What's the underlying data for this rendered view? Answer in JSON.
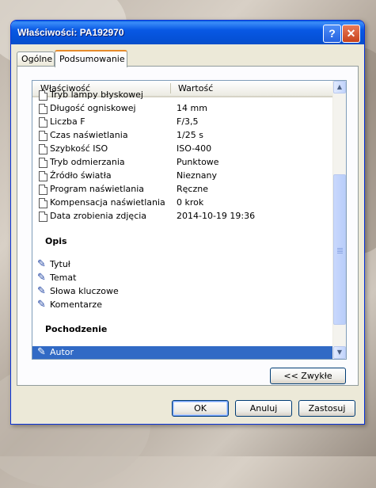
{
  "window": {
    "title": "Właściwości: PA192970"
  },
  "titlebar": {
    "help_glyph": "?",
    "close_glyph": "✕"
  },
  "tabs": [
    {
      "label": "Ogólne"
    },
    {
      "label": "Podsumowanie"
    }
  ],
  "list": {
    "headers": {
      "property": "Właściwość",
      "value": "Wartość"
    },
    "partial_row": {
      "label": "Tryb lampy błyskowej"
    },
    "rows": [
      {
        "label": "Długość ogniskowej",
        "value": "14 mm"
      },
      {
        "label": "Liczba F",
        "value": "F/3,5"
      },
      {
        "label": "Czas naświetlania",
        "value": "1/25 s"
      },
      {
        "label": "Szybkość ISO",
        "value": "ISO-400"
      },
      {
        "label": "Tryb odmierzania",
        "value": "Punktowe"
      },
      {
        "label": "Źródło światła",
        "value": "Nieznany"
      },
      {
        "label": "Program naświetlania",
        "value": "Ręczne"
      },
      {
        "label": "Kompensacja naświetlania",
        "value": "0 krok"
      },
      {
        "label": "Data zrobienia zdjęcia",
        "value": "2014-10-19 19:36"
      }
    ],
    "section_opis": "Opis",
    "opis_items": [
      {
        "label": "Tytuł"
      },
      {
        "label": "Temat"
      },
      {
        "label": "Słowa kluczowe"
      },
      {
        "label": "Komentarze"
      }
    ],
    "section_pochodzenie": "Pochodzenie",
    "pochodzenie_items": [
      {
        "label": "Autor",
        "selected": true
      }
    ]
  },
  "scrollbar": {
    "up_glyph": "▲",
    "down_glyph": "▼"
  },
  "buttons": {
    "simple": "<< Zwykłe",
    "ok": "OK",
    "cancel": "Anuluj",
    "apply": "Zastosuj"
  },
  "colors": {
    "titlebar": "#0858e4",
    "selection": "#316ac5",
    "dialog_bg": "#ece9d8",
    "close_button": "#c8421b"
  }
}
